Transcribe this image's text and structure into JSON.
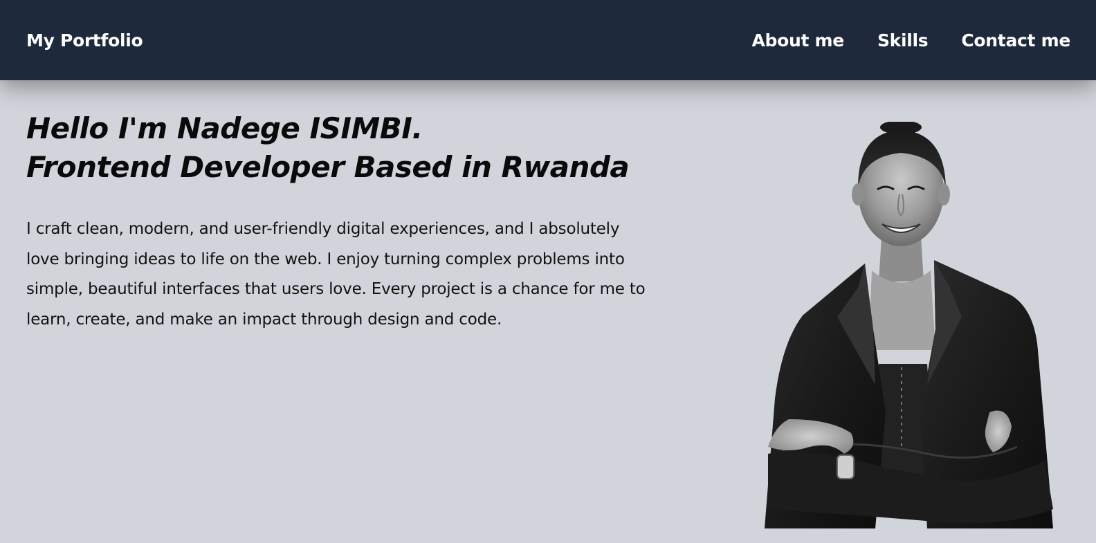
{
  "nav": {
    "brand": "My Portfolio",
    "links": [
      {
        "label": "About me"
      },
      {
        "label": "Skills"
      },
      {
        "label": "Contact me"
      }
    ]
  },
  "hero": {
    "heading_line1": "Hello I'm Nadege ISIMBI.",
    "heading_line2": "Frontend Developer Based in Rwanda",
    "intro": "I craft clean, modern, and user-friendly digital experiences, and I absolutely love bringing ideas to life on the web. I enjoy turning complex problems into simple, beautiful interfaces that users love. Every project is a chance for me to learn, create, and make an impact through design and code."
  },
  "colors": {
    "navbar_bg": "#1e293b",
    "page_bg": "#d1d5db",
    "nav_text": "#ffffff",
    "body_text": "#111111"
  }
}
